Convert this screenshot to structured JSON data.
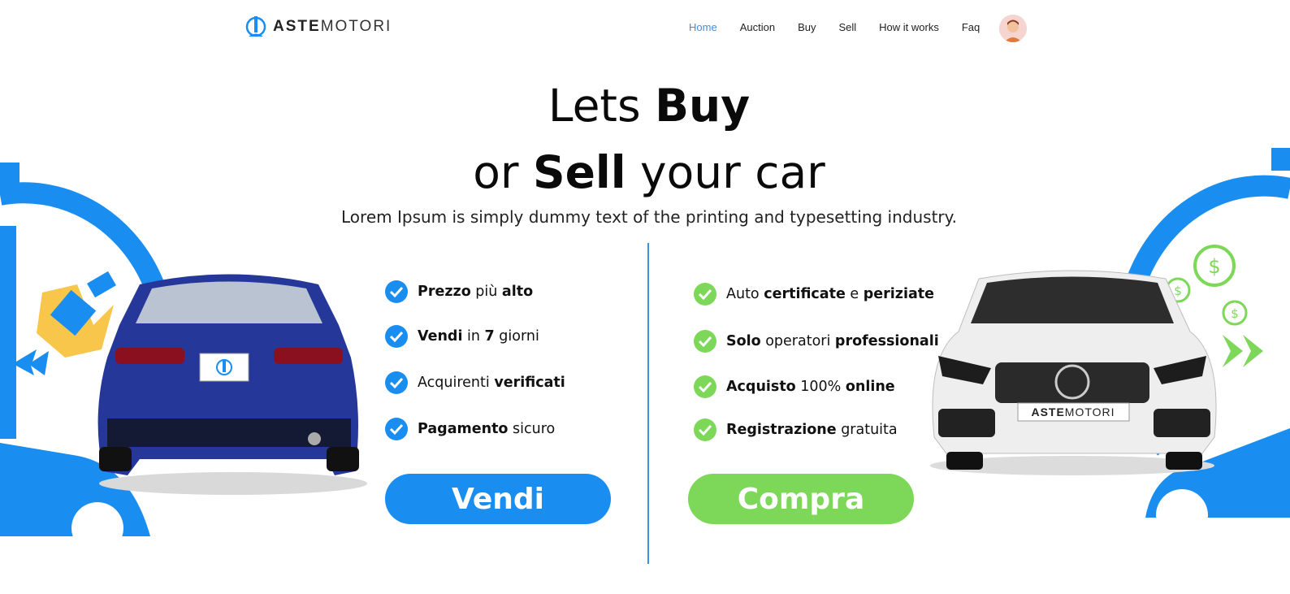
{
  "header": {
    "logo": {
      "bold": "ASTE",
      "light": "MOTORI"
    },
    "nav": [
      {
        "label": "Home",
        "active": true
      },
      {
        "label": "Auction",
        "active": false
      },
      {
        "label": "Buy",
        "active": false
      },
      {
        "label": "Sell",
        "active": false
      },
      {
        "label": "How it works",
        "active": false
      },
      {
        "label": "Faq",
        "active": false
      }
    ]
  },
  "hero": {
    "line1_pre": "Lets ",
    "line1_bold": "Buy",
    "line2_pre": "or ",
    "line2_bold": "Sell",
    "line2_post": " your car",
    "subtitle": "Lorem Ipsum is simply dummy text of the printing and typesetting industry."
  },
  "sell_features": [
    {
      "a": "Prezzo",
      "b": " più ",
      "c": "alto"
    },
    {
      "a": "Vendi",
      "b": " in ",
      "c": "7",
      "d": " giorni"
    },
    {
      "a": "",
      "b": "Acquirenti ",
      "c": "verificati"
    },
    {
      "a": "Pagamento",
      "b": " sicuro"
    }
  ],
  "buy_features": [
    {
      "b": "Auto ",
      "a": "certificate",
      "c": " e ",
      "d": "periziate"
    },
    {
      "a": "Solo",
      "b": " operatori ",
      "c": "professionali"
    },
    {
      "a": "Acquisto",
      "b": " 100% ",
      "c": "online"
    },
    {
      "a": "Registrazione",
      "b": " gratuita"
    }
  ],
  "buttons": {
    "sell": "Vendi",
    "buy": "Compra"
  },
  "plate_text": {
    "bold": "ASTE",
    "light": "MOTORI"
  },
  "colors": {
    "blue": "#1a8ef0",
    "green": "#7dd85a",
    "nav_active": "#3d8fe0"
  }
}
